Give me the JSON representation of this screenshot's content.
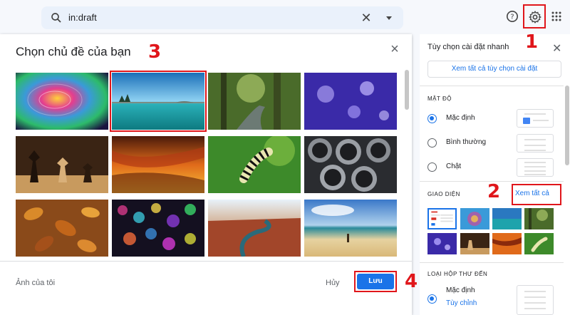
{
  "search": {
    "query": "in:draft"
  },
  "dialog": {
    "title": "Chọn chủ đề của bạn",
    "my_photos": "Ảnh của tôi",
    "cancel": "Hủy",
    "save": "Lưu"
  },
  "panel": {
    "title": "Tùy chọn cài đặt nhanh",
    "see_all_settings": "Xem tất cả tùy chọn cài đặt",
    "density_heading": "MẬT ĐỘ",
    "density_options": [
      {
        "label": "Mặc định",
        "selected": true
      },
      {
        "label": "Bình thường",
        "selected": false
      },
      {
        "label": "Chật",
        "selected": false
      }
    ],
    "theme_heading": "GIAO DIỆN",
    "see_all_themes": "Xem tất cả",
    "inbox_type_heading": "LOẠI HỘP THƯ ĐẾN",
    "inbox_default": "Mặc định",
    "customize": "Tùy chỉnh"
  },
  "step_labels": {
    "step1": "1",
    "step2": "2",
    "step3": "3",
    "step4": "4"
  },
  "colors": {
    "accent": "#1a73e8",
    "highlight": "#e0161b"
  },
  "themes": [
    {
      "name": "rainbow-water",
      "selected": false
    },
    {
      "name": "lake-island",
      "selected": true
    },
    {
      "name": "forest-stream",
      "selected": false
    },
    {
      "name": "jellyfish",
      "selected": false
    },
    {
      "name": "chess",
      "selected": false
    },
    {
      "name": "canyon-rock",
      "selected": false
    },
    {
      "name": "caterpillar",
      "selected": false
    },
    {
      "name": "pipes",
      "selected": false
    },
    {
      "name": "autumn-leaves",
      "selected": false
    },
    {
      "name": "bokeh-lights",
      "selected": false
    },
    {
      "name": "canyon-river",
      "selected": false
    },
    {
      "name": "beach",
      "selected": false
    }
  ]
}
